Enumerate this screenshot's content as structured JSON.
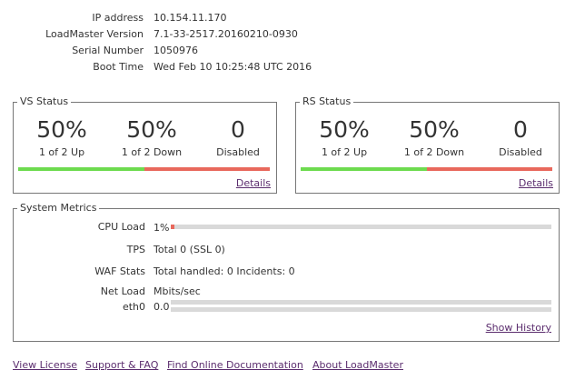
{
  "system_info": [
    {
      "label": "IP address",
      "value": "10.154.11.170"
    },
    {
      "label": "LoadMaster Version",
      "value": "7.1-33-2517.20160210-0930"
    },
    {
      "label": "Serial Number",
      "value": "1050976"
    },
    {
      "label": "Boot Time",
      "value": "Wed Feb 10 10:25:48 UTC 2016"
    }
  ],
  "vs_status": {
    "title": "VS Status",
    "up_pct": "50%",
    "up_text": "1 of 2 Up",
    "down_pct": "50%",
    "down_text": "1 of 2 Down",
    "disabled_count": "0",
    "disabled_text": "Disabled",
    "up_fraction": 0.5,
    "details_label": "Details"
  },
  "rs_status": {
    "title": "RS Status",
    "up_pct": "50%",
    "up_text": "1 of 2 Up",
    "down_pct": "50%",
    "down_text": "1 of 2 Down",
    "disabled_count": "0",
    "disabled_text": "Disabled",
    "up_fraction": 0.5,
    "details_label": "Details"
  },
  "system_metrics": {
    "title": "System Metrics",
    "cpu_label": "CPU Load",
    "cpu_value": "1%",
    "cpu_fraction": 0.01,
    "tps_label": "TPS",
    "tps_value": "Total 0 (SSL 0)",
    "waf_label": "WAF Stats",
    "waf_value": "Total handled: 0 Incidents: 0",
    "net_label": "Net Load",
    "net_unit": "Mbits/sec",
    "iface_label": "eth0",
    "iface_value": "0.0",
    "show_history_label": "Show History"
  },
  "footer": {
    "links": [
      "View License",
      "Support & FAQ",
      "Find Online Documentation",
      "About LoadMaster"
    ]
  },
  "colors": {
    "up": "#6ddb4f",
    "down": "#e8685c",
    "link": "#5b2d6e",
    "track": "#d9d9d9"
  }
}
